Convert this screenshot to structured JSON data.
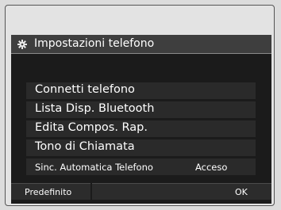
{
  "header": {
    "title": "Impostazioni telefono",
    "icon": "gear-icon"
  },
  "menu": {
    "items": [
      {
        "label": "Connetti telefono"
      },
      {
        "label": "Lista Disp. Bluetooth"
      },
      {
        "label": "Edita Compos. Rap."
      },
      {
        "label": "Tono di Chiamata"
      },
      {
        "label": "Sinc. Automatica Telefono",
        "value": "Acceso"
      }
    ]
  },
  "footer": {
    "default_label": "Predefinito",
    "ok_label": "OK"
  },
  "colors": {
    "screen_background": "#1b1b1b",
    "title_bar": "#3e3e3e",
    "menu_item_background": "#2a2a2a",
    "text": "#ffffff"
  }
}
